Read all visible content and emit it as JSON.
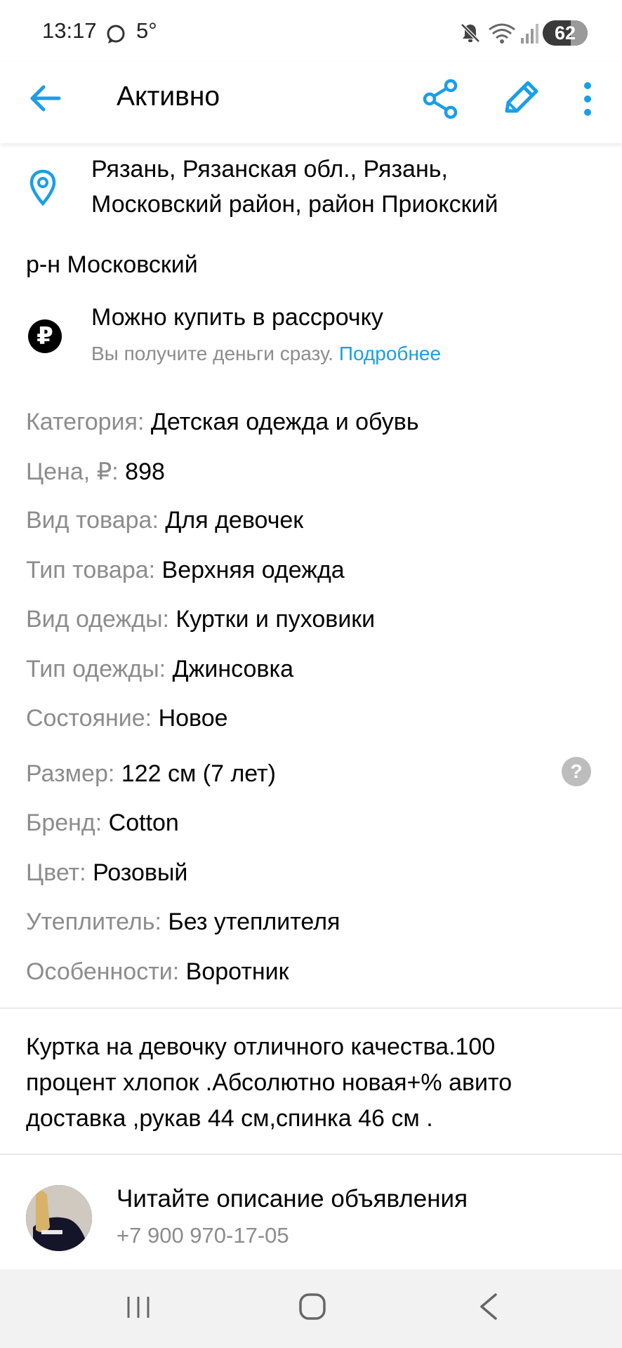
{
  "status_bar": {
    "time": "13:17",
    "temperature": "5°",
    "battery_level": "62",
    "icons": [
      "chat-icon",
      "mute-icon",
      "wifi-icon",
      "signal-icon",
      "battery-icon"
    ]
  },
  "app_bar": {
    "title": "Активно",
    "icons": [
      "back-arrow-icon",
      "share-icon",
      "edit-pencil-icon",
      "more-vert-icon"
    ],
    "accent_color": "#1a9ee8"
  },
  "location": {
    "line1": "Рязань, Рязанская обл., Рязань,",
    "line2": "Московский район, район Приокский",
    "district": "р-н Московский"
  },
  "installment": {
    "title": "Можно купить в рассрочку",
    "subtitle": "Вы получите деньги сразу.",
    "link": "Подробнее",
    "icon_glyph": "₽"
  },
  "params": [
    {
      "key": "Категория:",
      "value": "Детская одежда и обувь"
    },
    {
      "key": "Цена, ₽:",
      "value": "898"
    },
    {
      "key": "Вид товара:",
      "value": "Для девочек"
    },
    {
      "key": "Тип товара:",
      "value": "Верхняя одежда"
    },
    {
      "key": "Вид одежды:",
      "value": "Куртки и пуховики"
    },
    {
      "key": "Тип одежды:",
      "value": "Джинсовка"
    },
    {
      "key": "Состояние:",
      "value": "Новое"
    },
    {
      "key": "Размер:",
      "value": "122 см (7 лет)"
    },
    {
      "key": "Бренд:",
      "value": "Cotton"
    },
    {
      "key": "Цвет:",
      "value": "Розовый"
    },
    {
      "key": "Утеплитель:",
      "value": "Без утеплителя"
    },
    {
      "key": "Особенности:",
      "value": "Воротник"
    }
  ],
  "help_glyph": "?",
  "description": {
    "lines": [
      "Куртка на девочку отличного качества.100",
      "процент хлопок .Абсолютно новая+% авито",
      "доставка ,рукав 44 см,спинка 46 см ."
    ]
  },
  "seller": {
    "name": "Читайте описание объявления",
    "phone": "+7 900 970-17-05"
  },
  "nav_bar": {
    "icons": [
      "recent-apps-icon",
      "home-icon",
      "back-icon"
    ]
  }
}
